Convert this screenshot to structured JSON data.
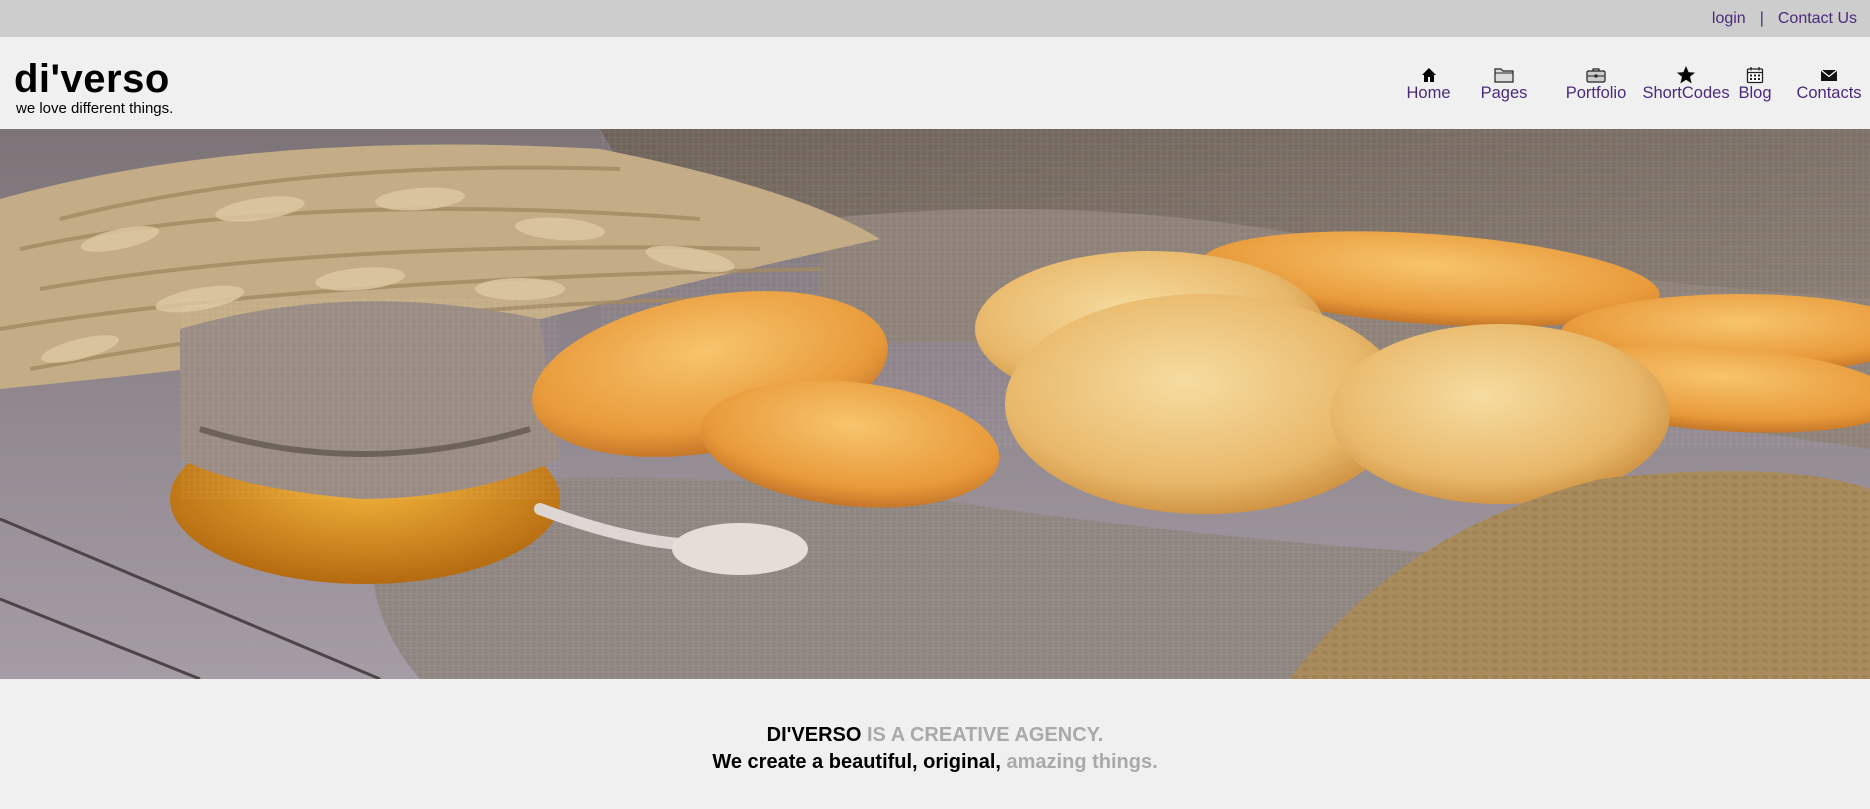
{
  "topbar": {
    "login": "login",
    "separator": "|",
    "contact": "Contact Us"
  },
  "brand": {
    "logo": "di'verso",
    "tagline": "we love different things."
  },
  "nav": {
    "items": [
      {
        "label": "Home",
        "icon": "home-icon"
      },
      {
        "label": "Pages",
        "icon": "folder-icon"
      },
      {
        "label": "Portfolio",
        "icon": "briefcase-icon"
      },
      {
        "label": "ShortCodes",
        "icon": "star-icon"
      },
      {
        "label": "Blog",
        "icon": "calendar-icon"
      },
      {
        "label": "Contacts",
        "icon": "envelope-icon"
      }
    ]
  },
  "hero": {
    "subject": "bread-and-wheat-photo"
  },
  "tagline": {
    "line1_brand": "DI'VERSO",
    "line1_rest": "IS A CREATIVE AGENCY.",
    "line2_dark": "We create a beautiful, original,",
    "line2_light": "amazing things."
  },
  "colors": {
    "link": "#4b2a7a",
    "topbar_bg": "#cdcdcd",
    "page_bg": "#f0f0f0",
    "muted_text": "#a9a9a9"
  }
}
